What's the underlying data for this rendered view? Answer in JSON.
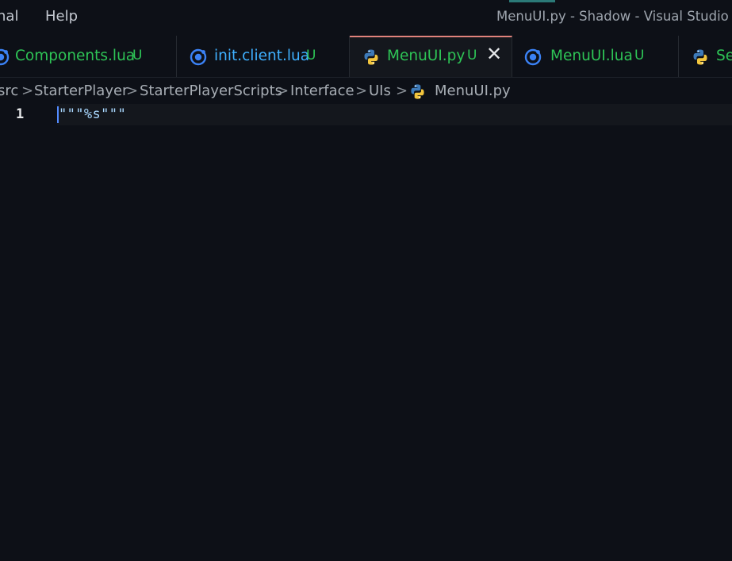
{
  "menubar": {
    "items": [
      {
        "label": "inal"
      },
      {
        "label": "Help"
      }
    ]
  },
  "window": {
    "title": "MenuUI.py - Shadow - Visual Studio C"
  },
  "tabs": [
    {
      "label": "Components.lua",
      "badge": "U",
      "icon": "lua-icon"
    },
    {
      "label": "init.client.lua",
      "badge": "U",
      "icon": "lua-icon"
    },
    {
      "label": "MenuUI.py",
      "badge": "U",
      "icon": "python-icon",
      "active": true,
      "close": "✕"
    },
    {
      "label": "MenuUI.lua",
      "badge": "U",
      "icon": "lua-icon"
    },
    {
      "label": "Se",
      "badge": "",
      "icon": "python-icon"
    }
  ],
  "breadcrumb": {
    "items": [
      "src",
      "StarterPlayer",
      "StarterPlayerScripts",
      "Interface",
      "UIs",
      "MenuUI.py"
    ],
    "separator": ">"
  },
  "editor": {
    "lines": [
      {
        "number": "1",
        "text": "\"\"\"%s\"\"\""
      }
    ]
  },
  "colors": {
    "background": "#0d1017",
    "tab_active": "#14171d",
    "tab_active_border": "#e0827b",
    "git_untracked": "#2ec456",
    "string": "#a9d8ff"
  }
}
